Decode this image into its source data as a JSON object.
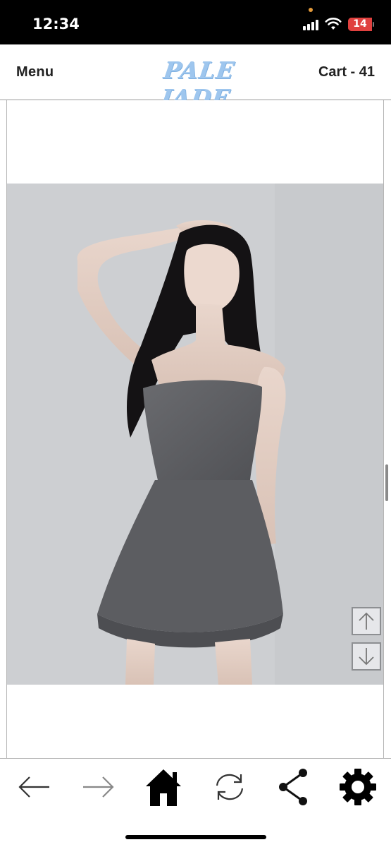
{
  "status_bar": {
    "time": "12:34",
    "battery_level": "14",
    "battery_color": "#e0413f",
    "icons": [
      "signal-icon",
      "wifi-icon",
      "battery-icon"
    ]
  },
  "header": {
    "menu_label": "Menu",
    "brand": "PALE JADE",
    "cart_label": "Cart - 41",
    "brand_color": "#9ec6ee"
  },
  "product": {
    "image_alt": "Gray strapless mini dress on model",
    "image_icon": "product-photo"
  },
  "scroll_controls": {
    "up_icon": "arrow-up-icon",
    "down_icon": "arrow-down-icon"
  },
  "toolbar": {
    "items": [
      {
        "name": "back",
        "icon": "arrow-left-icon"
      },
      {
        "name": "forward",
        "icon": "arrow-right-icon"
      },
      {
        "name": "home",
        "icon": "home-icon"
      },
      {
        "name": "reload",
        "icon": "refresh-icon"
      },
      {
        "name": "share",
        "icon": "share-icon"
      },
      {
        "name": "settings",
        "icon": "gear-icon"
      }
    ]
  }
}
